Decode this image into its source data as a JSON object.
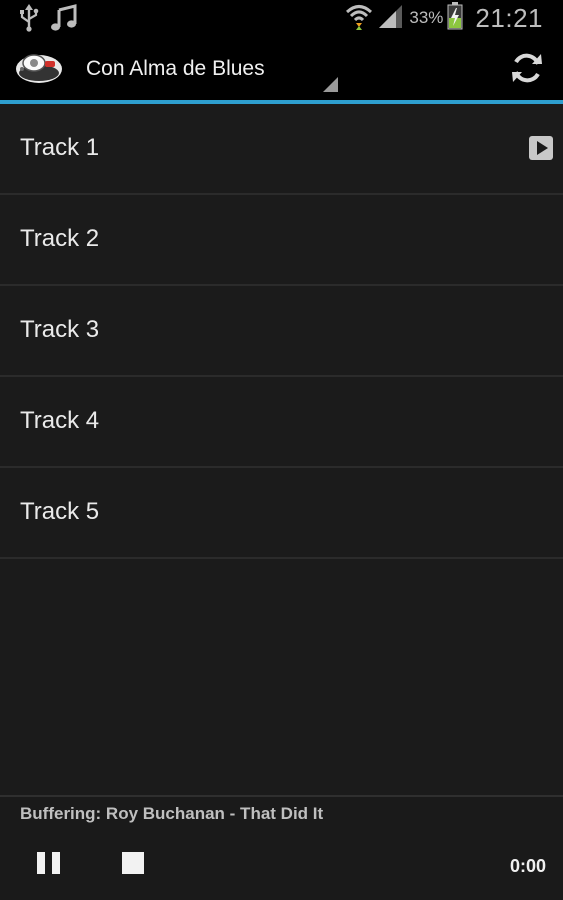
{
  "status_bar": {
    "icons_left": [
      "usb-icon",
      "music-note-icon"
    ],
    "icons_right": [
      "wifi-icon",
      "signal-icon",
      "battery-charging-icon"
    ],
    "battery_percent": "33%",
    "time": "21:21"
  },
  "action_bar": {
    "app_icon": "radio-icon",
    "station_title": "Con Alma de Blues",
    "refresh_icon": "refresh-icon",
    "accent_color": "#2e9fcf"
  },
  "tracks": [
    {
      "label": "Track 1",
      "playing": true
    },
    {
      "label": "Track 2",
      "playing": false
    },
    {
      "label": "Track 3",
      "playing": false
    },
    {
      "label": "Track 4",
      "playing": false
    },
    {
      "label": "Track 5",
      "playing": false
    }
  ],
  "player": {
    "status": "Buffering: Roy Buchanan - That Did It",
    "pause_icon": "pause-icon",
    "stop_icon": "stop-icon",
    "time": "0:00"
  }
}
